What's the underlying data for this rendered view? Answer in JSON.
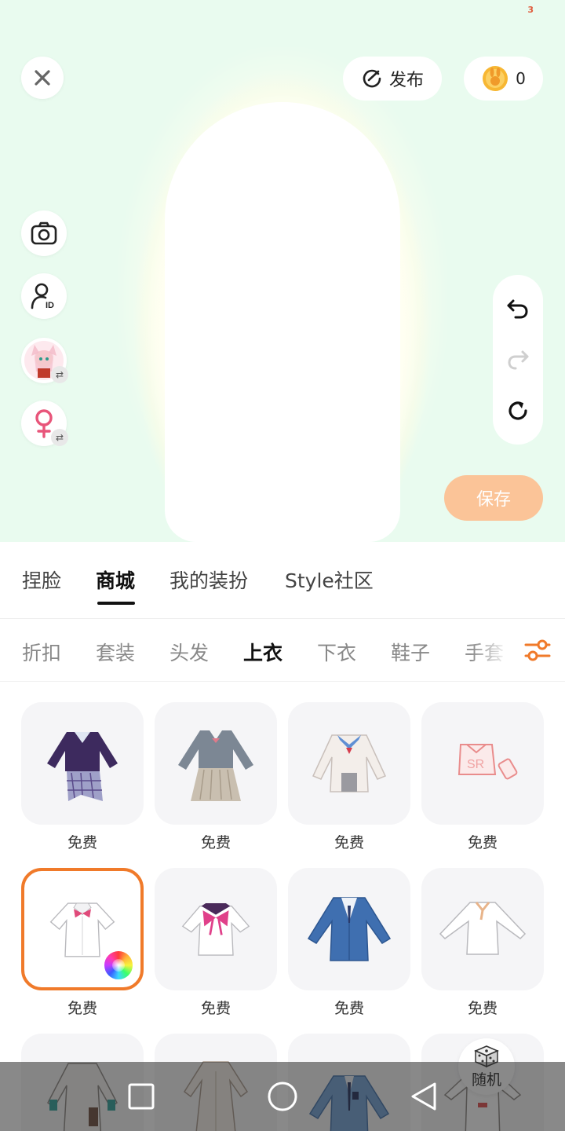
{
  "status": {
    "badge_number": "3"
  },
  "header": {
    "close_icon": "close-icon",
    "publish_label": "发布",
    "coins": "0"
  },
  "side_tools": [
    "camera-icon",
    "user-id-icon",
    "character-switch",
    "gender-switch"
  ],
  "history_tools": [
    "undo-icon",
    "redo-icon",
    "reset-icon"
  ],
  "save_label": "保存",
  "main_tabs": [
    {
      "label": "捏脸",
      "active": false
    },
    {
      "label": "商城",
      "active": true
    },
    {
      "label": "我的装扮",
      "active": false
    },
    {
      "label": "Style社区",
      "active": false
    }
  ],
  "categories": [
    {
      "label": "折扣",
      "active": false
    },
    {
      "label": "套装",
      "active": false
    },
    {
      "label": "头发",
      "active": false
    },
    {
      "label": "上衣",
      "active": true
    },
    {
      "label": "下衣",
      "active": false
    },
    {
      "label": "鞋子",
      "active": false
    },
    {
      "label": "手套",
      "active": false
    }
  ],
  "items": [
    {
      "name": "purple-plaid-outfit",
      "price": "免费"
    },
    {
      "name": "gray-school-uniform",
      "price": "免费"
    },
    {
      "name": "white-sailor-jacket",
      "price": "免费"
    },
    {
      "name": "pink-crop-top",
      "price": "免费"
    },
    {
      "name": "white-bow-shirt",
      "price": "免费",
      "selected": true
    },
    {
      "name": "sailor-bow-shirt",
      "price": "免费"
    },
    {
      "name": "blue-blazer",
      "price": "免费"
    },
    {
      "name": "white-long-sleeve",
      "price": "免费"
    },
    {
      "name": "white-trench-coat",
      "price": ""
    },
    {
      "name": "beige-long-dress",
      "price": ""
    },
    {
      "name": "blue-uniform-jacket",
      "price": ""
    },
    {
      "name": "white-jacket",
      "price": ""
    }
  ],
  "random_label": "随机",
  "colors": {
    "accent": "#f07a2a",
    "save_bg": "#fbc498",
    "preview_bg": "#e9fbee"
  }
}
